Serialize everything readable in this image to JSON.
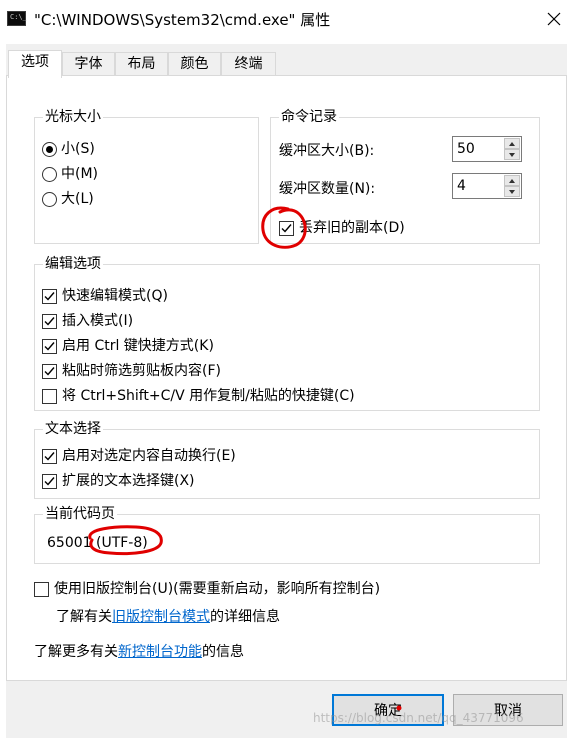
{
  "window": {
    "title": "\"C:\\WINDOWS\\System32\\cmd.exe\" 属性",
    "icon_label": "C:\\_"
  },
  "tabs": [
    "选项",
    "字体",
    "布局",
    "颜色",
    "终端"
  ],
  "active_tab": "选项",
  "cursor_size": {
    "title": "光标大小",
    "options": [
      {
        "label": "小(S)",
        "selected": true
      },
      {
        "label": "中(M)",
        "selected": false
      },
      {
        "label": "大(L)",
        "selected": false
      }
    ]
  },
  "command_history": {
    "title": "命令记录",
    "buffer_size_label": "缓冲区大小(B):",
    "buffer_size_value": "50",
    "buffer_count_label": "缓冲区数量(N):",
    "buffer_count_value": "4",
    "discard_old_label": "丢弃旧的副本(D)",
    "discard_old_checked": true
  },
  "edit_options": {
    "title": "编辑选项",
    "items": [
      {
        "label": "快速编辑模式(Q)",
        "checked": true
      },
      {
        "label": "插入模式(I)",
        "checked": true
      },
      {
        "label": "启用 Ctrl 键快捷方式(K)",
        "checked": true
      },
      {
        "label": "粘贴时筛选剪贴板内容(F)",
        "checked": true
      },
      {
        "label": "将 Ctrl+Shift+C/V 用作复制/粘贴的快捷键(C)",
        "checked": false
      }
    ]
  },
  "text_selection": {
    "title": "文本选择",
    "items": [
      {
        "label": "启用对选定内容自动换行(E)",
        "checked": true
      },
      {
        "label": "扩展的文本选择键(X)",
        "checked": true
      }
    ]
  },
  "code_page": {
    "title": "当前代码页",
    "value": "65001 (UTF-8)"
  },
  "legacy": {
    "label": "使用旧版控制台(U)(需要重新启动，影响所有控制台)",
    "checked": false,
    "learn_prefix": "了解有关",
    "learn_link": "旧版控制台模式",
    "learn_suffix": "的详细信息"
  },
  "new_features": {
    "prefix": "了解更多有关",
    "link": "新控制台功能",
    "suffix": "的信息"
  },
  "buttons": {
    "ok": "确定",
    "cancel": "取消"
  },
  "watermark": "https://blog.csdn.net/qq_43771096",
  "colors": {
    "link": "#0066cc",
    "annotation": "#e00000",
    "default_button_border": "#0078d7"
  }
}
